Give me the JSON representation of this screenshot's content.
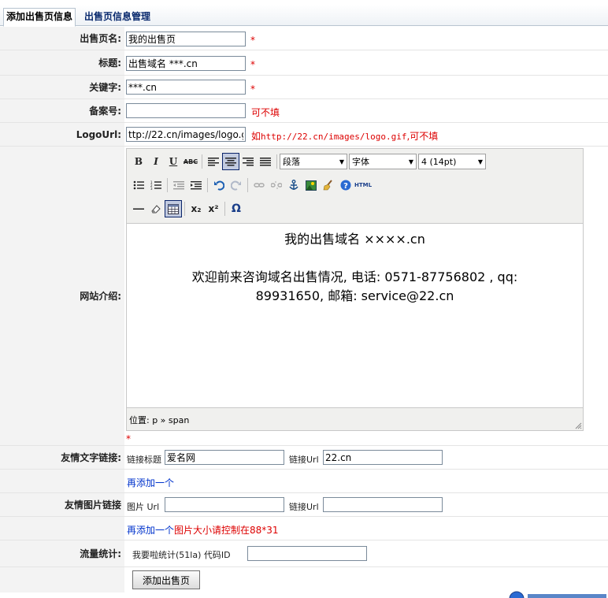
{
  "tabs": [
    {
      "label": "添加出售页信息",
      "active": true
    },
    {
      "label": "出售页信息管理",
      "active": false
    }
  ],
  "form": {
    "page_name": {
      "label": "出售页名:",
      "value": "我的出售页",
      "required": "*"
    },
    "title": {
      "label": "标题:",
      "value": "出售域名 ***.cn",
      "required": "*"
    },
    "keywords": {
      "label": "关键字:",
      "value": "***.cn",
      "required": "*"
    },
    "icp": {
      "label": "备案号:",
      "value": "",
      "hint": "可不填"
    },
    "logo_url": {
      "label": "LogoUrl:",
      "value": "ttp://22.cn/images/logo.gif",
      "hint_prefix": "如",
      "hint_example": "http://22.cn/images/logo.gif",
      "hint_suffix": ",可不填"
    },
    "intro": {
      "label": "网站介绍:",
      "required": "*",
      "toolbar": {
        "bold": "B",
        "italic": "I",
        "underline": "U",
        "strike": "ABC",
        "format_select": "段落",
        "font_select": "字体",
        "size_select": "4 (14pt)",
        "html": "HTML",
        "subscript": "x₂",
        "superscript": "x²",
        "omega": "Ω"
      },
      "content_line1": "我的出售域名 ××××.cn",
      "content_line2": "欢迎前来咨询域名出售情况, 电话: 0571-87756802 , qq:",
      "content_line3": "89931650, 邮箱: service@22.cn",
      "path": "位置: p » span"
    },
    "friend_text": {
      "label": "友情文字链接:",
      "title_label": "链接标题",
      "title_value": "爱名网",
      "url_label": "链接Url",
      "url_value": "22.cn",
      "add_more": "再添加一个"
    },
    "friend_image": {
      "label": "友情图片链接",
      "img_label": "图片 Url",
      "img_value": "",
      "url_label": "链接Url",
      "url_value": "",
      "add_more": "再添加一个",
      "hint": "图片大小请控制在88*31"
    },
    "stats": {
      "label": "流量统计:",
      "text": "我要啦统计(51la) 代码ID",
      "value": ""
    },
    "submit": "添加出售页"
  },
  "colors": {
    "required": "#dd0000",
    "link": "#0033cc",
    "label_bg": "#f3f3f3"
  }
}
